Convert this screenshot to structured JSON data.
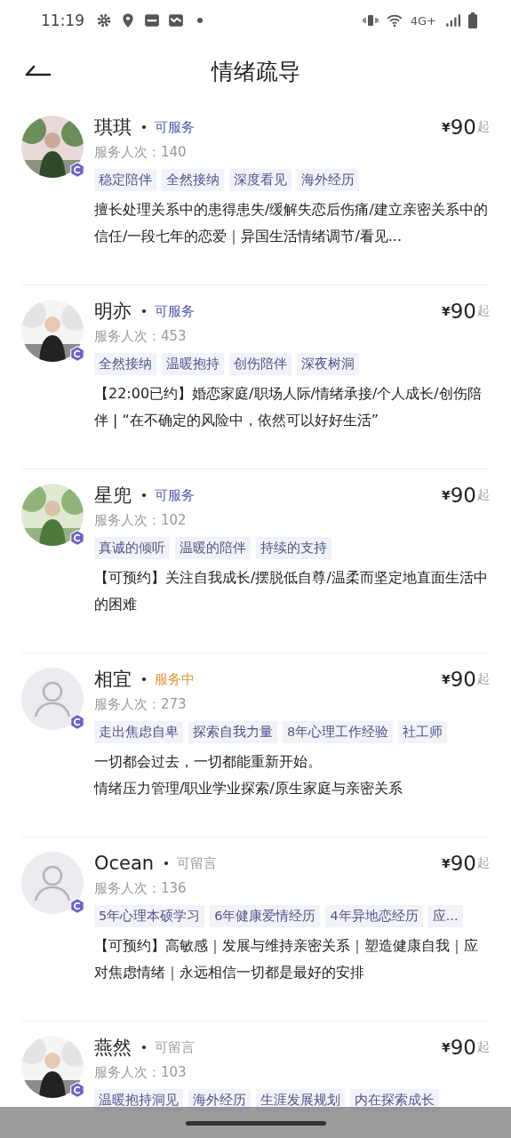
{
  "status_bar": {
    "time": "11:19",
    "network": "4G+"
  },
  "header": {
    "title": "情绪疏导"
  },
  "counselors": [
    {
      "name": "琪琪",
      "avatar": {
        "kind": "picture"
      },
      "status": {
        "label": "可服务",
        "kind": "available"
      },
      "count": "服务人次：140",
      "currency": "¥",
      "price": "90",
      "price_suffix": "起",
      "tags": [
        "稳定陪伴",
        "全然接纳",
        "深度看见",
        "海外经历"
      ],
      "description": [
        "擅长处理关系中的患得患失/缓解失恋后伤痛/建立亲密关系中的信任/一段七年的恋爱｜异国生活情绪调节/看见..."
      ]
    },
    {
      "name": "明亦",
      "avatar": {
        "kind": "picture"
      },
      "status": {
        "label": "可服务",
        "kind": "available"
      },
      "count": "服务人次：453",
      "currency": "¥",
      "price": "90",
      "price_suffix": "起",
      "tags": [
        "全然接纳",
        "温暖抱持",
        "创伤陪伴",
        "深夜树洞"
      ],
      "description": [
        "【22:00已约】婚恋家庭/职场人际/情绪承接/个人成长/创伤陪伴 | “在不确定的风险中，依然可以好好生活”"
      ]
    },
    {
      "name": "星兜",
      "avatar": {
        "kind": "picture"
      },
      "status": {
        "label": "可服务",
        "kind": "available"
      },
      "count": "服务人次：102",
      "currency": "¥",
      "price": "90",
      "price_suffix": "起",
      "tags": [
        "真诚的倾听",
        "温暖的陪伴",
        "持续的支持"
      ],
      "description": [
        "【可预约】关注自我成长/摆脱低自尊/温柔而坚定地直面生活中的困难"
      ]
    },
    {
      "name": "相宜",
      "avatar": {
        "kind": "placeholder"
      },
      "status": {
        "label": "服务中",
        "kind": "serving"
      },
      "count": "服务人次：273",
      "currency": "¥",
      "price": "90",
      "price_suffix": "起",
      "tags": [
        "走出焦虑自卑",
        "探索自我力量",
        "8年心理工作经验",
        "社工师"
      ],
      "description": [
        "一切都会过去，一切都能重新开始。",
        "情绪压力管理/职业学业探索/原生家庭与亲密关系"
      ]
    },
    {
      "name": "Ocean",
      "avatar": {
        "kind": "placeholder"
      },
      "status": {
        "label": "可留言",
        "kind": "message"
      },
      "count": "服务人次：136",
      "currency": "¥",
      "price": "90",
      "price_suffix": "起",
      "tags": [
        "5年心理本硕学习",
        "6年健康爱情经历",
        "4年异地恋经历",
        "应..."
      ],
      "description": [
        "【可预约】高敏感｜发展与维持亲密关系｜塑造健康自我｜应对焦虑情绪｜永远相信一切都是最好的安排"
      ]
    },
    {
      "name": "燕然",
      "avatar": {
        "kind": "picture"
      },
      "status": {
        "label": "可留言",
        "kind": "message"
      },
      "count": "服务人次：103",
      "currency": "¥",
      "price": "90",
      "price_suffix": "起",
      "tags": [
        "温暖抱持洞见",
        "海外经历",
        "生涯发展规划",
        "内在探索成长"
      ]
    }
  ]
}
